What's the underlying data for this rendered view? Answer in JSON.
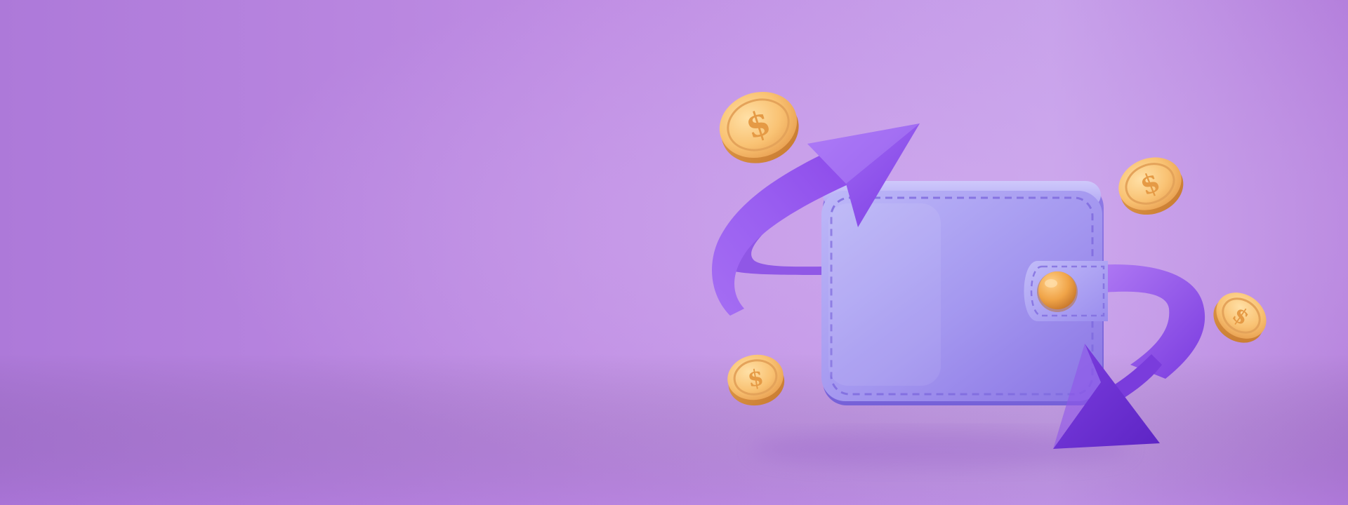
{
  "scene": {
    "background_colors": [
      "#b07fdc",
      "#c59ae8",
      "#c49ee9",
      "#b885df"
    ],
    "wallet_colors": [
      "#b9b4f6",
      "#a396ef",
      "#8a75e6"
    ],
    "arrow_colors": [
      "#b27cf6",
      "#8f52ec",
      "#6a2fd4"
    ],
    "coin_colors": [
      "#ffd590",
      "#f2b05a",
      "#d38a3b"
    ],
    "button_color": "#f0a448",
    "icons": [
      "wallet-icon",
      "exchange-arrows-icon",
      "dollar-coin-icon"
    ]
  }
}
